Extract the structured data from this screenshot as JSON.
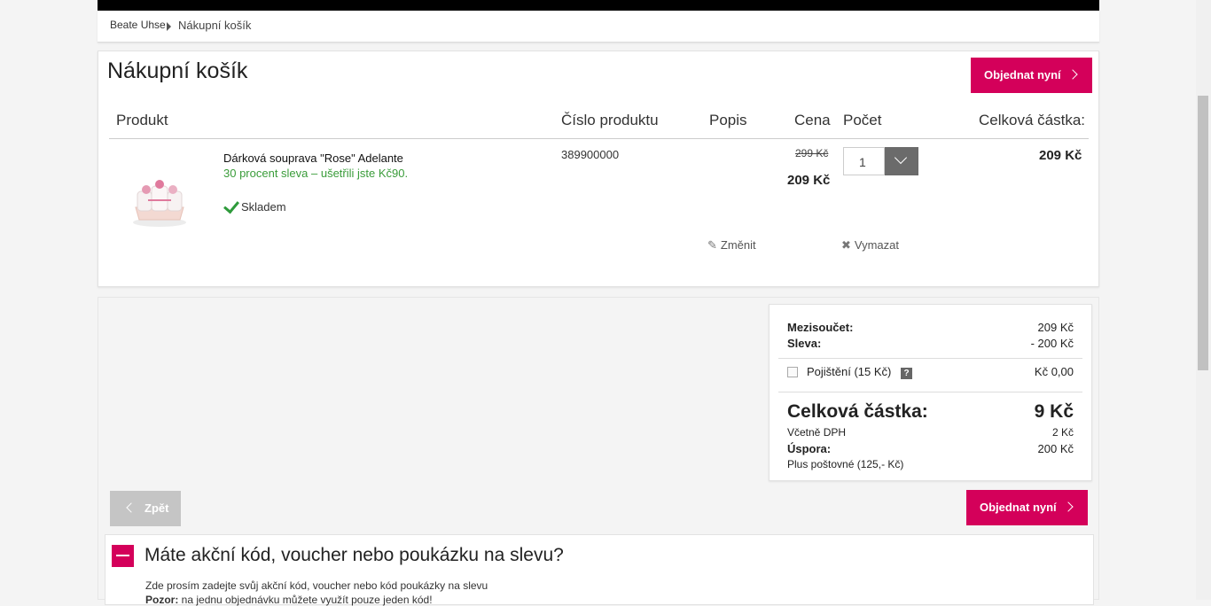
{
  "breadcrumb": {
    "home": "Beate Uhse",
    "current": "Nákupní košík"
  },
  "cart": {
    "title": "Nákupní košík",
    "order_button": "Objednat nyní",
    "columns": {
      "product": "Produkt",
      "number": "Číslo produktu",
      "description": "Popis",
      "price": "Cena",
      "quantity": "Počet",
      "total": "Celková částka:"
    },
    "item": {
      "name": "Dárková souprava \"Rose\" Adelante",
      "discount_text": "30 procent sleva – ušetřili jste Kč90.",
      "stock": "Skladem",
      "product_number": "389900000",
      "old_price": "299 Kč",
      "price": "209 Kč",
      "quantity": "1",
      "total": "209 Kč",
      "edit_label": "Změnit",
      "delete_label": "Vymazat"
    }
  },
  "summary": {
    "subtotal_label": "Mezisoučet:",
    "subtotal_value": "209 Kč",
    "discount_label": "Sleva:",
    "discount_value": "- 200 Kč",
    "insurance_label": "Pojištění (15 Kč)",
    "insurance_help": "?",
    "insurance_value": "Kč 0,00",
    "total_label": "Celková částka:",
    "total_value": "9 Kč",
    "vat_label": "Včetně DPH",
    "vat_value": "2 Kč",
    "savings_label": "Úspora:",
    "savings_value": "200 Kč",
    "shipping_note": "Plus poštovné (125,- Kč)"
  },
  "nav": {
    "back_button": "Zpět",
    "order_button": "Objednat nyní"
  },
  "voucher": {
    "title": "Máte akční kód, voucher nebo poukázku na slevu?",
    "text": "Zde prosím zadejte svůj akční kód, voucher nebo kód poukázky na slevu",
    "note_bold": "Pozor:",
    "note": " na jednu objednávku můžete využít pouze jeden kód!"
  },
  "colors": {
    "accent": "#d4005a",
    "success": "#3a9c3a"
  }
}
